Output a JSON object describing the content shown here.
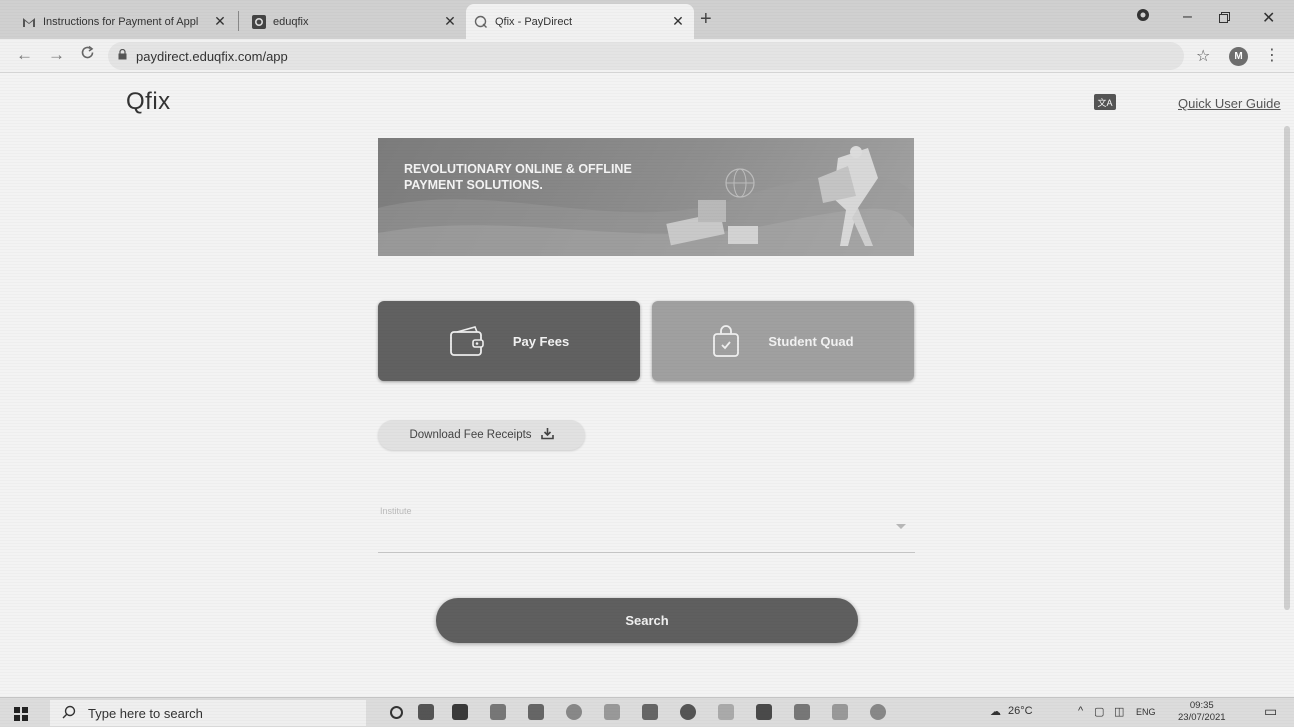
{
  "browser": {
    "tabs": [
      {
        "title": "Instructions for Payment of Appl"
      },
      {
        "title": "eduqfix"
      },
      {
        "title": "Qfix - PayDirect",
        "active": true
      }
    ],
    "url": "paydirect.eduqfix.com/app",
    "profile_initial": "M"
  },
  "header": {
    "logo_text": "Qfix",
    "quick_user_guide": "Quick User Guide"
  },
  "banner": {
    "text_line1": "REVOLUTIONARY ONLINE & OFFLINE",
    "text_line2": "PAYMENT SOLUTIONS."
  },
  "actions": {
    "pay_fees": "Pay Fees",
    "student_quad": "Student Quad",
    "download_receipts": "Download Fee Receipts"
  },
  "form": {
    "institute_label": "Institute",
    "search_label": "Search"
  },
  "taskbar": {
    "search_placeholder": "Type here to search",
    "temperature": "26°C",
    "language": "ENG",
    "time": "09:35",
    "date": "23/07/2021"
  },
  "colors": {
    "pay_fees_tile": "#616161",
    "student_quad_tile": "#a0a0a0",
    "search_button": "#5f5f5f"
  }
}
